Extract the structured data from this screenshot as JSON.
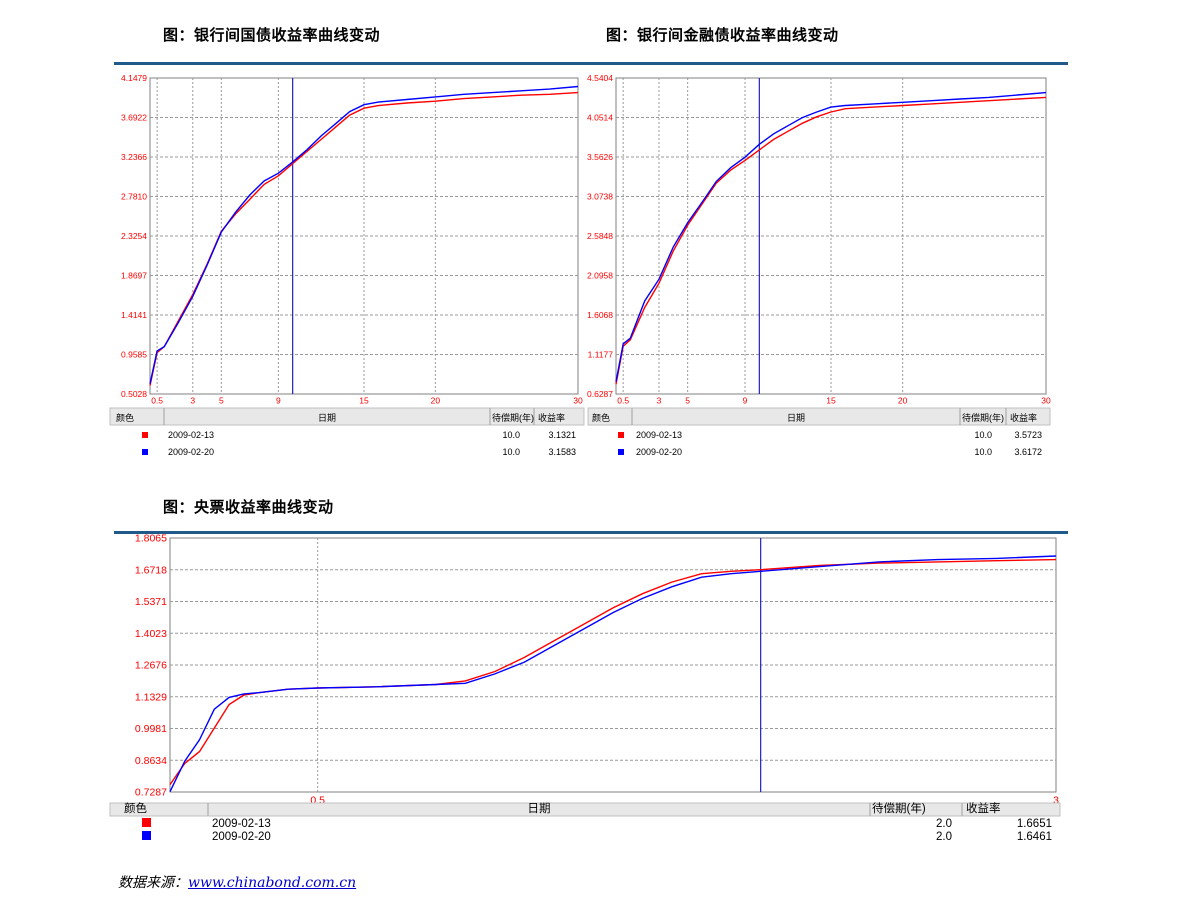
{
  "charts": [
    {
      "heading": "图：银行间国债收益率曲线变动",
      "chart_data": {
        "type": "line",
        "title": "图：银行间国债收益率曲线变动",
        "x_ticks": [
          "0.5",
          "3",
          "5",
          "9",
          "15",
          "20",
          "30"
        ],
        "y_ticks": [
          "0.5028",
          "0.9585",
          "1.4141",
          "1.8697",
          "2.3254",
          "2.7810",
          "3.2366",
          "3.6922",
          "4.1479"
        ],
        "ylim": [
          0.5028,
          4.1479
        ],
        "xlim": [
          0,
          30
        ],
        "cursor_x": 10,
        "grid": true,
        "series": [
          {
            "name": "2009-02-13",
            "color": "#ff0000",
            "x": [
              0,
              0.5,
              1,
              2,
              3,
              4,
              5,
              6,
              7,
              8,
              9,
              10,
              11,
              12,
              13,
              14,
              15,
              16,
              18,
              20,
              22,
              24,
              26,
              28,
              30
            ],
            "values": [
              0.6,
              0.98,
              1.05,
              1.35,
              1.65,
              2.0,
              2.38,
              2.58,
              2.75,
              2.92,
              3.02,
              3.16,
              3.3,
              3.44,
              3.58,
              3.72,
              3.8,
              3.83,
              3.86,
              3.88,
              3.91,
              3.93,
              3.95,
              3.96,
              3.98
            ]
          },
          {
            "name": "2009-02-20",
            "color": "#0000ff",
            "x": [
              0,
              0.5,
              1,
              2,
              3,
              4,
              5,
              6,
              7,
              8,
              9,
              10,
              11,
              12,
              13,
              14,
              15,
              16,
              18,
              20,
              22,
              24,
              26,
              28,
              30
            ],
            "values": [
              0.62,
              1.0,
              1.05,
              1.33,
              1.63,
              1.99,
              2.37,
              2.6,
              2.8,
              2.96,
              3.05,
              3.18,
              3.32,
              3.48,
              3.62,
              3.76,
              3.84,
              3.87,
              3.9,
              3.93,
              3.96,
              3.98,
              4.0,
              4.02,
              4.05
            ]
          }
        ],
        "table": {
          "headers": [
            "颜色",
            "日期",
            "待偿期(年)",
            "收益率"
          ],
          "rows": [
            {
              "color": "#ff0000",
              "date": "2009-02-13",
              "maturity": "10.0",
              "yield": "3.1321"
            },
            {
              "color": "#0000ff",
              "date": "2009-02-20",
              "maturity": "10.0",
              "yield": "3.1583"
            }
          ]
        }
      }
    },
    {
      "heading": "图：银行间金融债收益率曲线变动",
      "chart_data": {
        "type": "line",
        "title": "图：银行间金融债收益率曲线变动",
        "x_ticks": [
          "0.5",
          "3",
          "5",
          "9",
          "15",
          "20",
          "30"
        ],
        "y_ticks": [
          "0.6287",
          "1.1177",
          "1.6068",
          "2.0958",
          "2.5848",
          "3.0738",
          "3.5626",
          "4.0514",
          "4.5404"
        ],
        "ylim": [
          0.6287,
          4.5404
        ],
        "xlim": [
          0,
          30
        ],
        "cursor_x": 10,
        "grid": true,
        "series": [
          {
            "name": "2009-02-13",
            "color": "#ff0000",
            "x": [
              0,
              0.5,
              1,
              2,
              3,
              4,
              5,
              6,
              7,
              8,
              9,
              10,
              11,
              12,
              13,
              14,
              15,
              16,
              18,
              20,
              22,
              24,
              26,
              28,
              30
            ],
            "values": [
              0.75,
              1.22,
              1.3,
              1.7,
              2.0,
              2.4,
              2.72,
              2.98,
              3.24,
              3.4,
              3.52,
              3.65,
              3.78,
              3.88,
              3.98,
              4.06,
              4.12,
              4.16,
              4.18,
              4.2,
              4.22,
              4.24,
              4.26,
              4.28,
              4.3
            ]
          },
          {
            "name": "2009-02-20",
            "color": "#0000ff",
            "x": [
              0,
              0.5,
              1,
              2,
              3,
              4,
              5,
              6,
              7,
              8,
              9,
              10,
              11,
              12,
              13,
              14,
              15,
              16,
              18,
              20,
              22,
              24,
              26,
              28,
              30
            ],
            "values": [
              0.78,
              1.25,
              1.32,
              1.78,
              2.05,
              2.45,
              2.75,
              3.0,
              3.26,
              3.43,
              3.56,
              3.72,
              3.85,
              3.95,
              4.05,
              4.12,
              4.18,
              4.2,
              4.22,
              4.24,
              4.26,
              4.28,
              4.3,
              4.33,
              4.36
            ]
          }
        ],
        "table": {
          "headers": [
            "颜色",
            "日期",
            "待偿期(年)",
            "收益率"
          ],
          "rows": [
            {
              "color": "#ff0000",
              "date": "2009-02-13",
              "maturity": "10.0",
              "yield": "3.5723"
            },
            {
              "color": "#0000ff",
              "date": "2009-02-20",
              "maturity": "10.0",
              "yield": "3.6172"
            }
          ]
        }
      }
    },
    {
      "heading": "图：央票收益率曲线变动",
      "chart_data": {
        "type": "line",
        "title": "图：央票收益率曲线变动",
        "x_ticks": [
          "0.5",
          "3"
        ],
        "y_ticks": [
          "0.7287",
          "0.8634",
          "0.9981",
          "1.1329",
          "1.2676",
          "1.4023",
          "1.5371",
          "1.6718",
          "1.8065"
        ],
        "ylim": [
          0.7287,
          1.8065
        ],
        "xlim": [
          0,
          3
        ],
        "cursor_x": 2,
        "grid": true,
        "series": [
          {
            "name": "2009-02-13",
            "color": "#ff0000",
            "x": [
              0,
              0.05,
              0.1,
              0.15,
              0.2,
              0.25,
              0.3,
              0.4,
              0.5,
              0.7,
              0.9,
              1.0,
              1.1,
              1.2,
              1.3,
              1.4,
              1.5,
              1.6,
              1.7,
              1.8,
              1.9,
              2.0,
              2.2,
              2.4,
              2.6,
              2.8,
              3.0
            ],
            "values": [
              0.76,
              0.85,
              0.9,
              1.0,
              1.1,
              1.14,
              1.15,
              1.165,
              1.17,
              1.175,
              1.185,
              1.2,
              1.24,
              1.3,
              1.37,
              1.44,
              1.51,
              1.57,
              1.62,
              1.655,
              1.665,
              1.672,
              1.69,
              1.7,
              1.705,
              1.71,
              1.715
            ]
          },
          {
            "name": "2009-02-20",
            "color": "#0000ff",
            "x": [
              0,
              0.05,
              0.1,
              0.15,
              0.2,
              0.25,
              0.3,
              0.4,
              0.5,
              0.7,
              0.9,
              1.0,
              1.1,
              1.2,
              1.3,
              1.4,
              1.5,
              1.6,
              1.7,
              1.8,
              1.9,
              2.0,
              2.2,
              2.4,
              2.6,
              2.8,
              3.0
            ],
            "values": [
              0.73,
              0.86,
              0.95,
              1.08,
              1.13,
              1.145,
              1.15,
              1.165,
              1.17,
              1.175,
              1.185,
              1.19,
              1.23,
              1.28,
              1.35,
              1.42,
              1.49,
              1.55,
              1.6,
              1.64,
              1.655,
              1.665,
              1.685,
              1.705,
              1.715,
              1.72,
              1.73
            ]
          }
        ],
        "table": {
          "headers": [
            "颜色",
            "日期",
            "待偿期(年)",
            "收益率"
          ],
          "rows": [
            {
              "color": "#ff0000",
              "date": "2009-02-13",
              "maturity": "2.0",
              "yield": "1.6651"
            },
            {
              "color": "#0000ff",
              "date": "2009-02-20",
              "maturity": "2.0",
              "yield": "1.6461"
            }
          ]
        }
      }
    }
  ],
  "source": {
    "label": "数据来源：",
    "link": "www.chinabond.com.cn"
  },
  "colors": {
    "rule": "#1f5a8a",
    "tick_text": "#ff0000",
    "grid": "#999999",
    "axis": "#808080"
  }
}
